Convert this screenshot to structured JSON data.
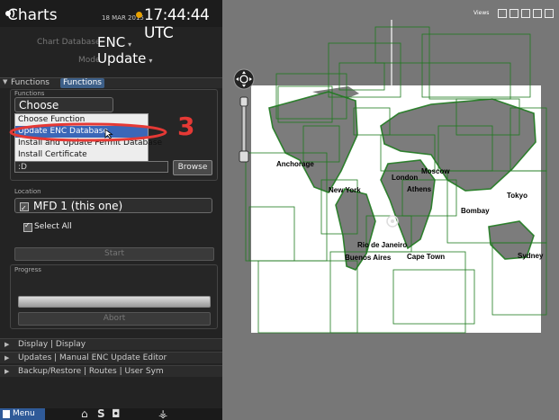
{
  "title_bar": {
    "app_title": "Charts",
    "date": "18 MAR 2015",
    "time": "17:44:44 UTC"
  },
  "chart_settings": {
    "database_label": "Chart Database",
    "database_value": "ENC",
    "mode_label": "Mode",
    "mode_value": "Update"
  },
  "functions_tabs": {
    "tab1": "Functions",
    "tab2": "Functions"
  },
  "functions_section": {
    "label": "Functions",
    "dropdown_value": "Choose Function",
    "menu_items": [
      "Choose Function",
      "Update ENC Database",
      "Install and Update Permit Database",
      "Install Certificate"
    ],
    "file_path": ":D",
    "browse_label": "Browse"
  },
  "location_section": {
    "label": "Location",
    "device": "MFD 1 (this one)",
    "select_all": "Select All",
    "start_label": "Start"
  },
  "progress_section": {
    "label": "Progress",
    "progress_value": 1.0,
    "abort_label": "Abort"
  },
  "accordion": {
    "display": "Display | Display",
    "updates": "Updates | Manual ENC Update Editor",
    "backup": "Backup/Restore | Routes | User Sym"
  },
  "bottom_bar": {
    "menu_label": "Menu"
  },
  "map": {
    "views_label": "Views",
    "cities": [
      "Anchorage",
      "London",
      "Moscow",
      "Athens",
      "New York",
      "Tokyo",
      "Bombay",
      "Rio de Janeiro",
      "Buenos Aires",
      "Cape Town",
      "Sydney"
    ]
  },
  "annotation": {
    "step_number": "3",
    "color": "#e53935"
  },
  "colors": {
    "chart_lines": "#1f7a1f",
    "tab_accent": "#3d5f88",
    "menu_highlight": "#3b67b8"
  }
}
